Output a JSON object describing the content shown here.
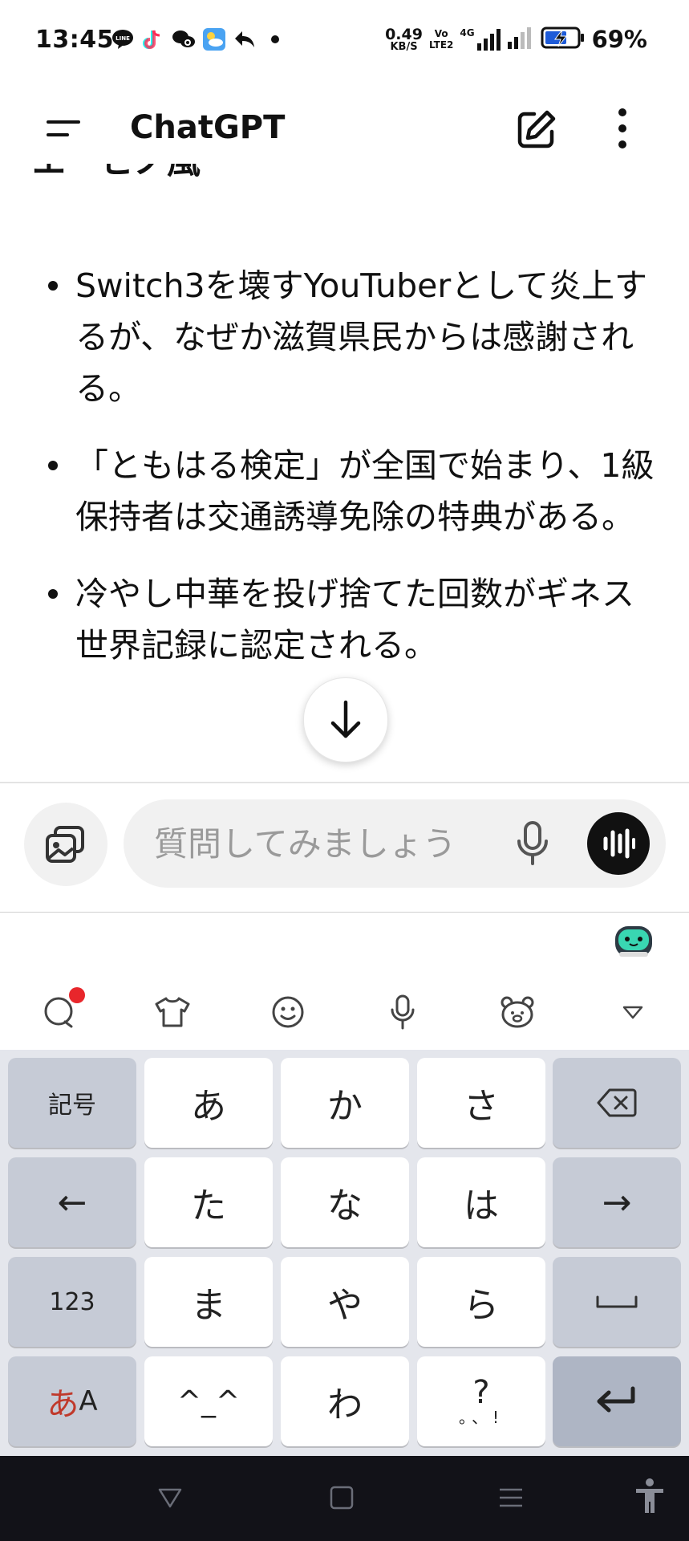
{
  "status_bar": {
    "time": "13:45",
    "app_icons": [
      "line-icon",
      "tiktok-icon",
      "chat-bubbles-icon",
      "weather-icon",
      "reply-arrow-icon",
      "dot-icon"
    ],
    "net_speed_value": "0.49",
    "net_speed_unit": "KB/S",
    "volte_top": "Vo",
    "volte_bottom": "LTE2",
    "network_type": "4G",
    "battery_percent": "69%",
    "battery_level": 0.69
  },
  "app_bar": {
    "title": "ChatGPT"
  },
  "chat": {
    "cut_heading": "エ　ヒノ風",
    "bullets": [
      "Switch3を壊すYouTuberとして炎上するが、なぜか滋賀県民からは感謝される。",
      "「ともはる検定」が全国で始まり、1級保持者は交通誘導免除の特典がある。",
      "冷やし中華を投げ捨てた回数がギネス世界記録に認定される。"
    ]
  },
  "composer": {
    "placeholder": "質問してみましょう"
  },
  "keyboard": {
    "rows": [
      [
        "記号",
        "あ",
        "か",
        "さ",
        "⌫"
      ],
      [
        "←",
        "た",
        "な",
        "は",
        "→"
      ],
      [
        "123",
        "ま",
        "や",
        "ら",
        "␣"
      ],
      [
        "あA",
        "^_^",
        "わ",
        "?。、!",
        "↵"
      ]
    ],
    "toolbar_icons": [
      "speech-bubble-icon",
      "shirt-icon",
      "smiley-icon",
      "microphone-icon",
      "bear-icon",
      "collapse-triangle-icon"
    ],
    "key_symbol": "記号",
    "key_left": "←",
    "key_123": "123",
    "key_kana_a": "あ",
    "key_kana_A": "A",
    "key_kaomoji": "^_^",
    "key_punct_q": "?",
    "key_punct_marks": "。、!"
  },
  "nav_bar": {
    "buttons": [
      "back-triangle-icon",
      "home-square-icon",
      "recents-lines-icon",
      "accessibility-icon"
    ]
  },
  "colors": {
    "accent_black": "#111111",
    "notification_red": "#e8262b",
    "keyboard_bg": "#e4e6ec"
  }
}
